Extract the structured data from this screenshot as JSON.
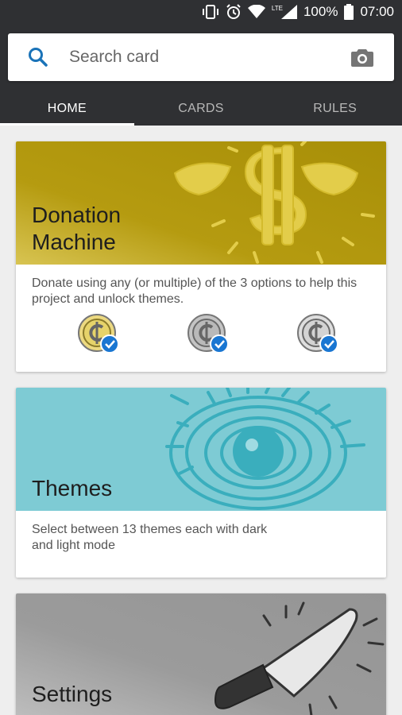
{
  "status_bar": {
    "battery": "100%",
    "time": "07:00",
    "network": "LTE"
  },
  "search": {
    "placeholder": "Search card"
  },
  "tabs": [
    {
      "label": "HOME",
      "active": true
    },
    {
      "label": "CARDS",
      "active": false
    },
    {
      "label": "RULES",
      "active": false
    }
  ],
  "cards": [
    {
      "title": "Donation\nMachine",
      "description": "Donate using any (or multiple) of the 3 options to help this project and unlock themes.",
      "accent": "#b59b10",
      "coins": [
        {
          "name": "gold-coin",
          "color": "#e6d36a",
          "checked": true
        },
        {
          "name": "silver-coin",
          "color": "#b9b9b9",
          "checked": true
        },
        {
          "name": "silver-coin-2",
          "color": "#d3d3d3",
          "checked": true
        }
      ]
    },
    {
      "title": "Themes",
      "description": "Select between 13 themes each with dark and light mode",
      "accent": "#7ecbd4"
    },
    {
      "title": "Settings",
      "accent": "#9b9b9b"
    }
  ],
  "colors": {
    "header": "#2f3033",
    "check": "#1976d2",
    "search_icon": "#1a73b8"
  }
}
